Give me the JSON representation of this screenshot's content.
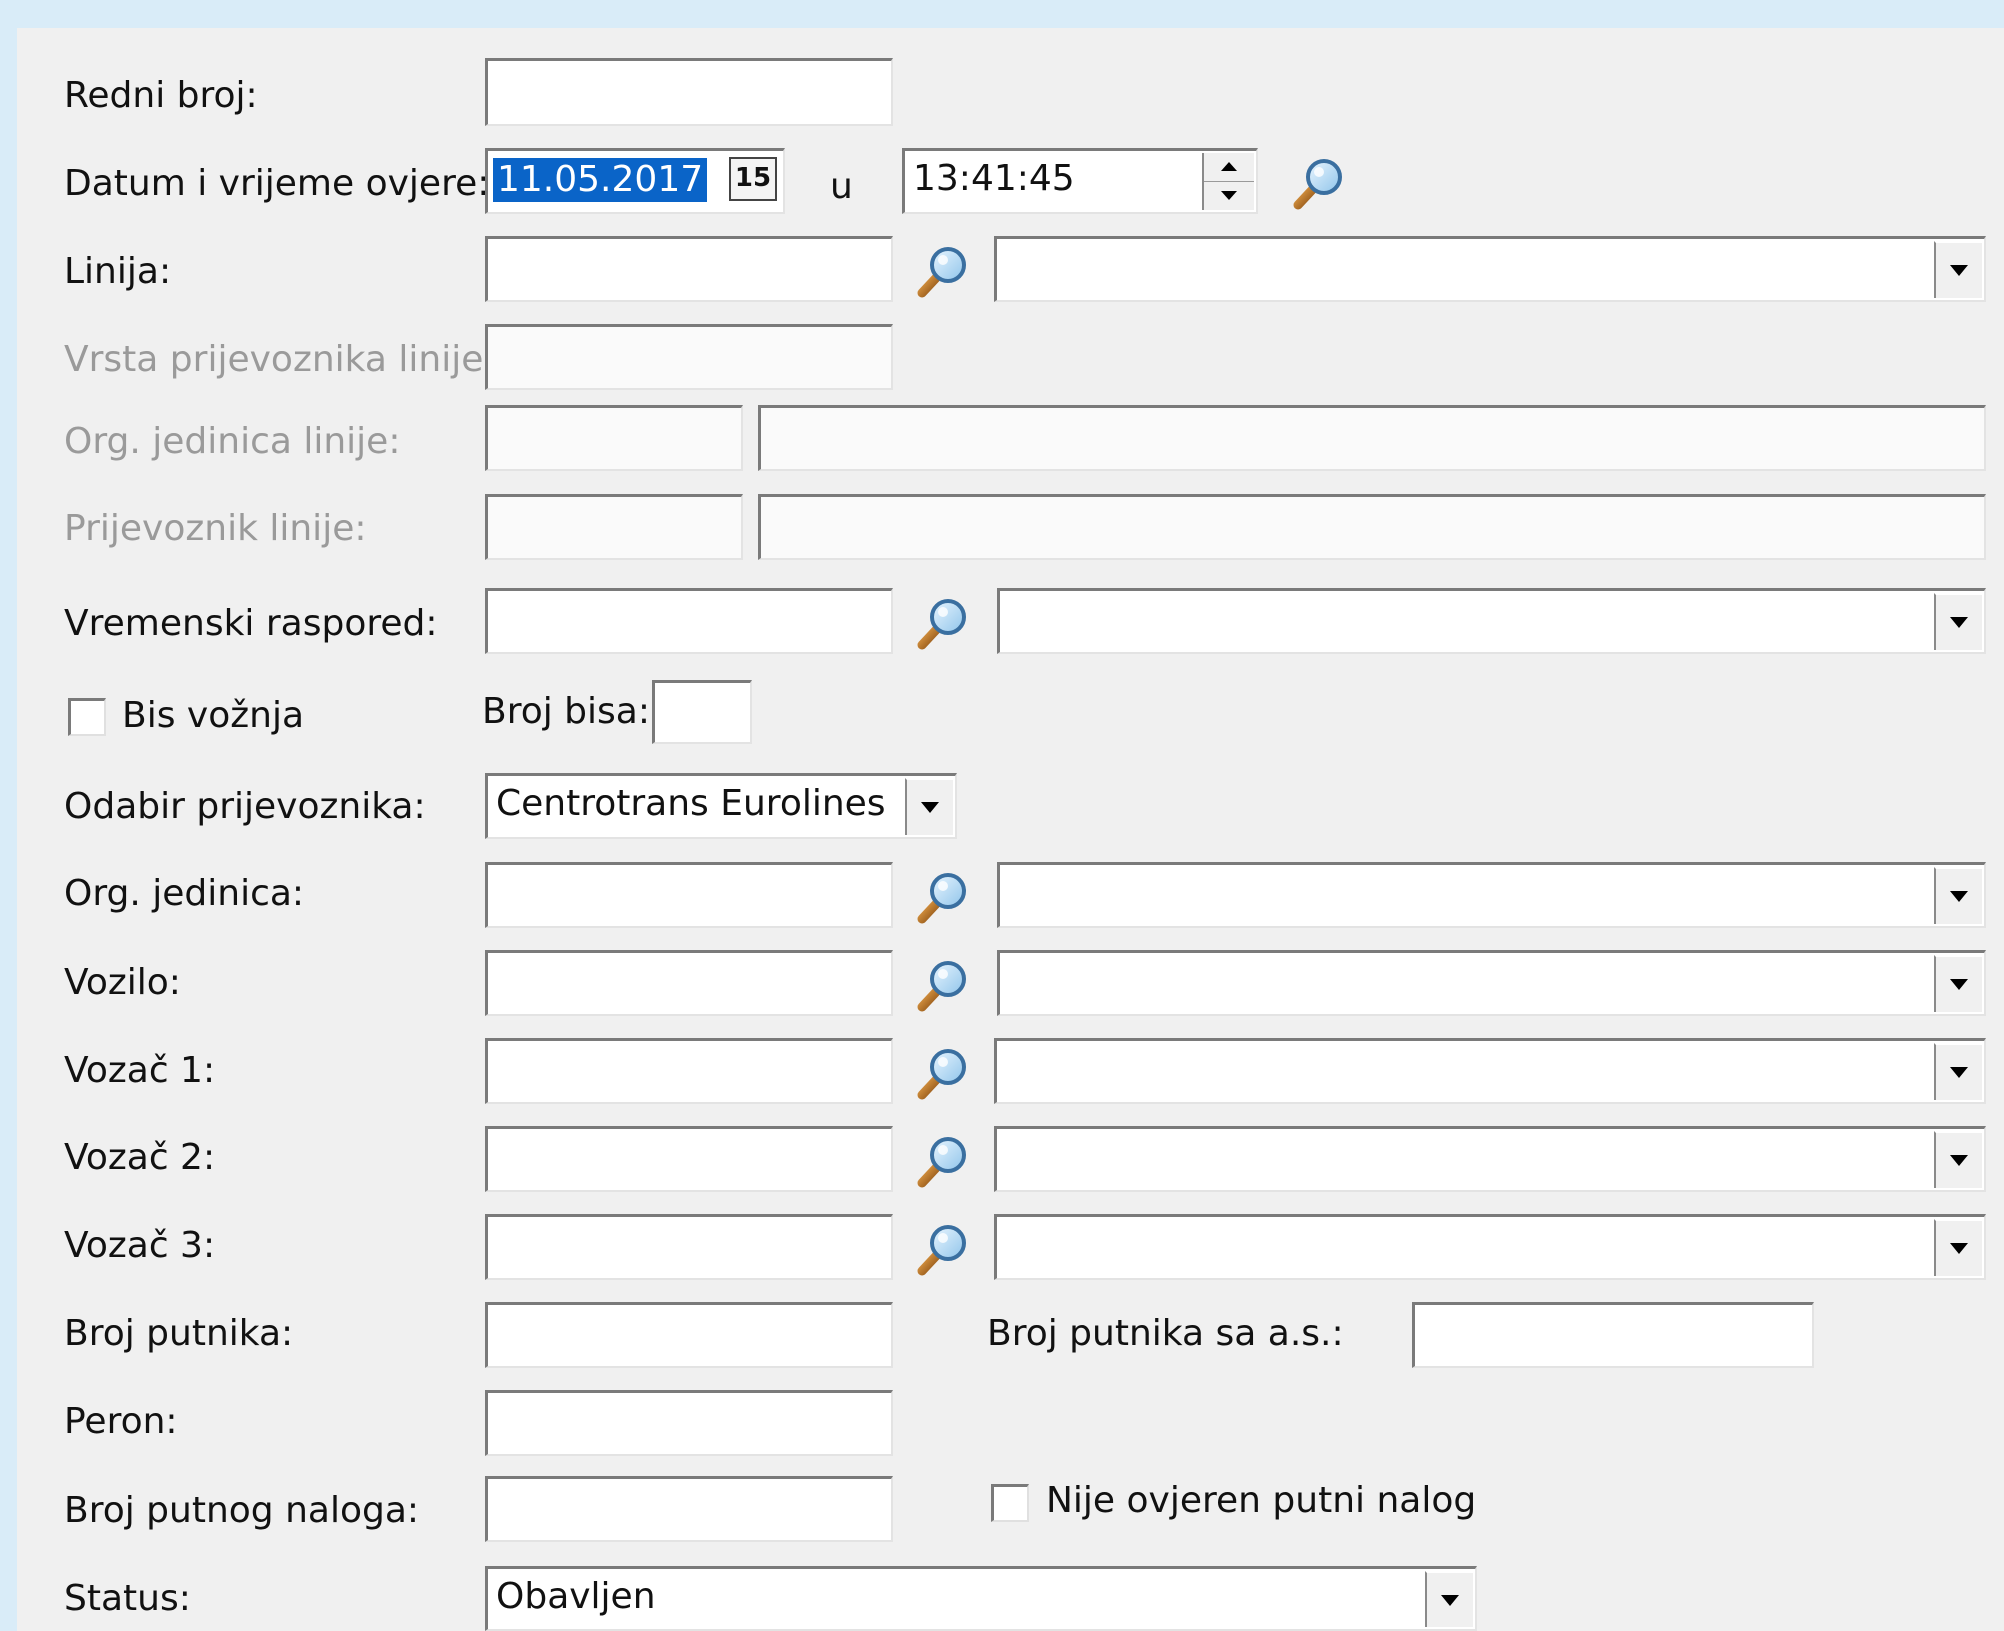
{
  "colors": {
    "frame_background": "#d9ecf8",
    "panel_background": "#f0f0f0",
    "selection_highlight": "#0a64c8",
    "disabled_label": "#9a9a9a"
  },
  "form": {
    "redni_broj": {
      "label": "Redni broj:",
      "value": ""
    },
    "datum_ovjere": {
      "label": "Datum i vrijeme ovjere:",
      "date_value": "11.05.2017",
      "calendar_icon_text": "15",
      "connector": "u",
      "time_value": "13:41:45"
    },
    "linija": {
      "label": "Linija:",
      "code": "",
      "name": ""
    },
    "vrsta_prijevoznika_linije": {
      "label": "Vrsta prijevoznika linije:",
      "value": ""
    },
    "org_jedinica_linije": {
      "label": "Org. jedinica linije:",
      "code": "",
      "name": ""
    },
    "prijevoznik_linije": {
      "label": "Prijevoznik linije:",
      "code": "",
      "name": ""
    },
    "vremenski_raspored": {
      "label": "Vremenski raspored:",
      "code": "",
      "name": ""
    },
    "bis_voznja": {
      "label": "Bis vožnja",
      "checked": false
    },
    "broj_bisa": {
      "label": "Broj bisa:",
      "value": ""
    },
    "odabir_prijevoznika": {
      "label": "Odabir prijevoznika:",
      "selected": "Centrotrans Eurolines"
    },
    "org_jedinica": {
      "label": "Org. jedinica:",
      "code": "",
      "name": ""
    },
    "vozilo": {
      "label": "Vozilo:",
      "code": "",
      "name": ""
    },
    "vozac1": {
      "label": "Vozač 1:",
      "code": "",
      "name": ""
    },
    "vozac2": {
      "label": "Vozač 2:",
      "code": "",
      "name": ""
    },
    "vozac3": {
      "label": "Vozač 3:",
      "code": "",
      "name": ""
    },
    "broj_putnika": {
      "label": "Broj putnika:",
      "value": ""
    },
    "broj_putnika_sa_as": {
      "label": "Broj putnika sa a.s.:",
      "value": ""
    },
    "peron": {
      "label": "Peron:",
      "value": ""
    },
    "broj_putnog_naloga": {
      "label": "Broj putnog naloga:",
      "value": ""
    },
    "nije_ovjeren": {
      "label": "Nije ovjeren putni nalog",
      "checked": false
    },
    "status": {
      "label": "Status:",
      "selected": "Obavljen"
    }
  },
  "icons": {
    "lookup": "magnifier-icon",
    "dropdown": "chevron-down-icon",
    "calendar": "calendar-icon",
    "spinner": "spinner-arrows-icon"
  }
}
